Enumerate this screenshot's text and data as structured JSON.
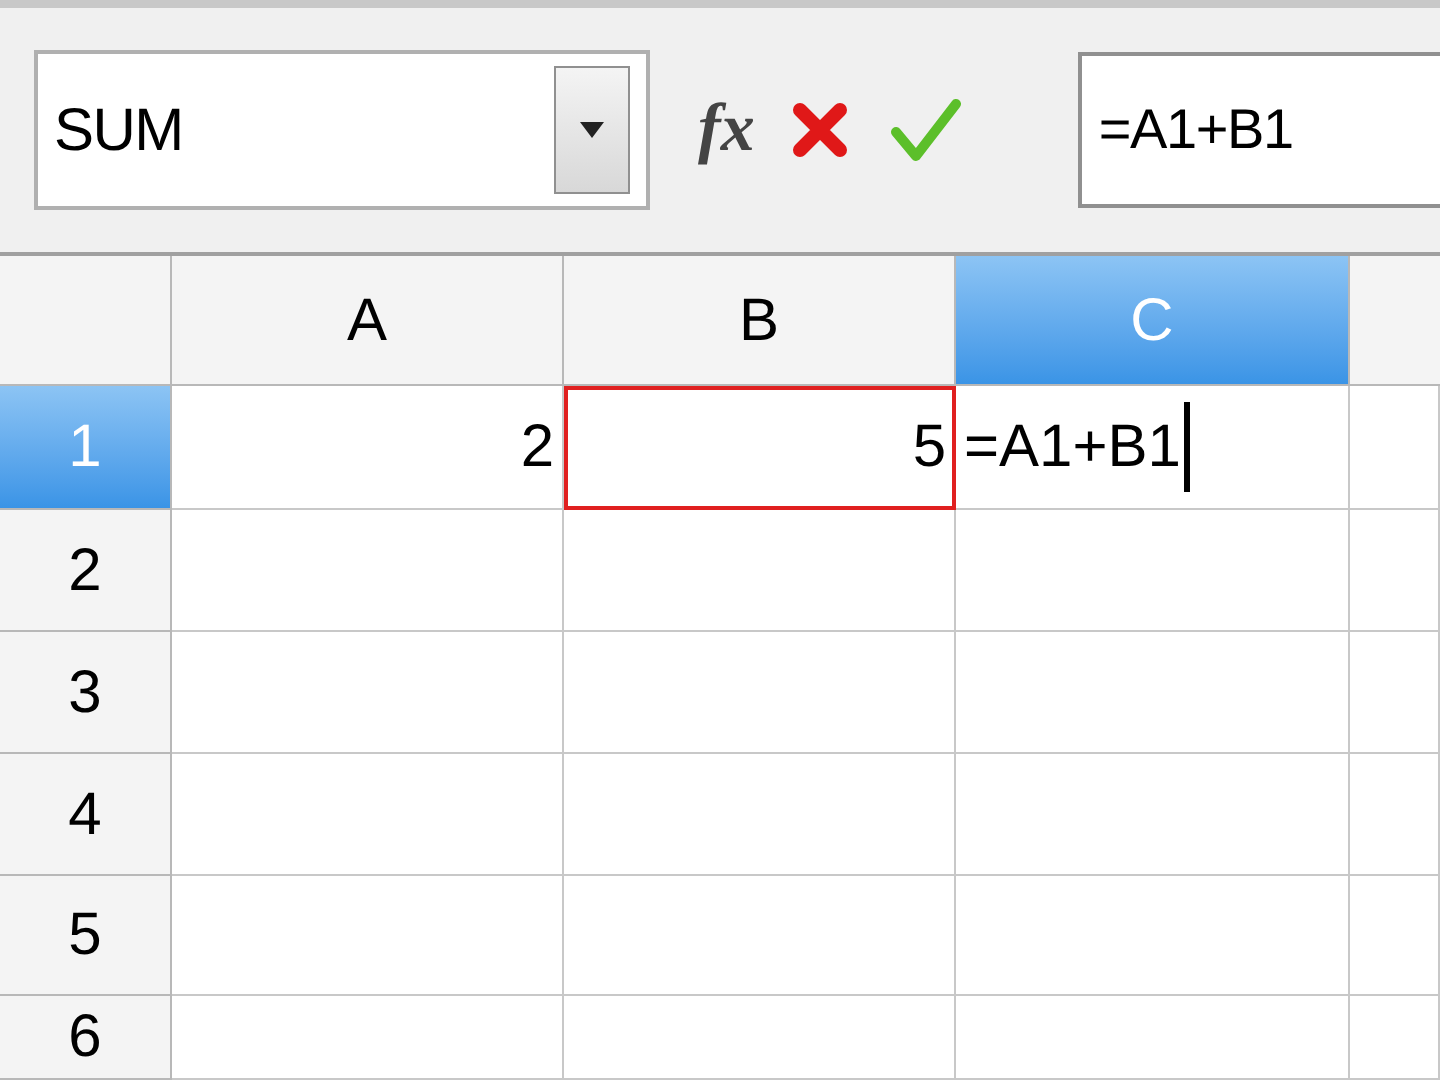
{
  "name_box": {
    "value": "SUM"
  },
  "function_wizard": {
    "label": "fx"
  },
  "formula_bar": {
    "value": "=A1+B1"
  },
  "columns": [
    {
      "label": "A",
      "selected": false
    },
    {
      "label": "B",
      "selected": false
    },
    {
      "label": "C",
      "selected": true
    }
  ],
  "rows": [
    {
      "label": "1",
      "selected": true,
      "cells": [
        {
          "value": "2",
          "highlighted": false,
          "editing": false
        },
        {
          "value": "5",
          "highlighted": true,
          "editing": false
        },
        {
          "value": "=A1+B1",
          "highlighted": false,
          "editing": true
        }
      ]
    },
    {
      "label": "2",
      "selected": false
    },
    {
      "label": "3",
      "selected": false
    },
    {
      "label": "4",
      "selected": false
    },
    {
      "label": "5",
      "selected": false
    },
    {
      "label": "6",
      "selected": false
    }
  ]
}
